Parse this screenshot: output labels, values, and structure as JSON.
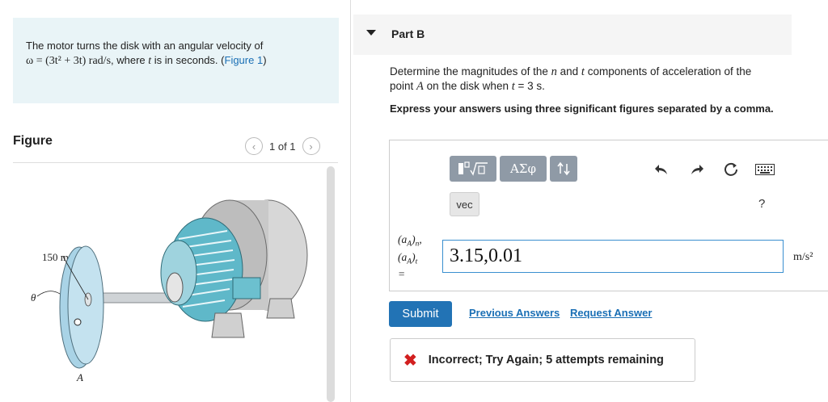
{
  "problem": {
    "text_before": "The motor turns the disk with an angular velocity of",
    "omega_expr": "ω = (3t² + 3t) rad/s",
    "text_after": ", where ",
    "t_symbol": "t",
    "text_tail": " is in seconds. (",
    "figure_link": "Figure 1",
    "close_paren": ")"
  },
  "figure_panel": {
    "title": "Figure",
    "pager_text": "1 of 1",
    "prev_icon": "chevron-left-icon",
    "next_icon": "chevron-right-icon",
    "radius_label": "150 mm",
    "theta_label": "θ",
    "point_label": "A"
  },
  "part": {
    "title": "Part B",
    "question_pre": "Determine the magnitudes of the ",
    "n_symbol": "n",
    "question_mid": " and ",
    "t_symbol": "t",
    "question_post": " components of acceleration of the",
    "question_line2_pre": "point ",
    "A_symbol": "A",
    "question_line2_mid": " on the disk when ",
    "t_symbol2": "t",
    "question_line2_post": " = 3 s.",
    "instruction": "Express your answers using three significant figures separated by a comma."
  },
  "toolbar": {
    "buttons": [
      "template-icon",
      "greek-symbols-icon",
      "sort-icon"
    ],
    "greek_label": "ΑΣφ",
    "vec_label": "vec",
    "help_label": "?",
    "actions": [
      "undo-icon",
      "redo-icon",
      "reset-icon",
      "keyboard-icon"
    ]
  },
  "answer": {
    "label_n_base": "(a",
    "label_n_sub": "A",
    "label_n_close": ")",
    "label_n_sub2": "n",
    "label_t_sub2": "t",
    "label_eq": "=",
    "value": "3.15,0.01",
    "unit": "m/s²"
  },
  "actions": {
    "submit": "Submit",
    "previous_answers": "Previous Answers",
    "request_answer": "Request Answer"
  },
  "feedback": {
    "icon": "x-icon",
    "text": "Incorrect; Try Again; 5 attempts remaining",
    "color": "#d21f1f"
  },
  "colors": {
    "accent": "#2273b5",
    "problem_bg": "#e9f4f7",
    "toolbar_bg": "#8f9aa6"
  }
}
